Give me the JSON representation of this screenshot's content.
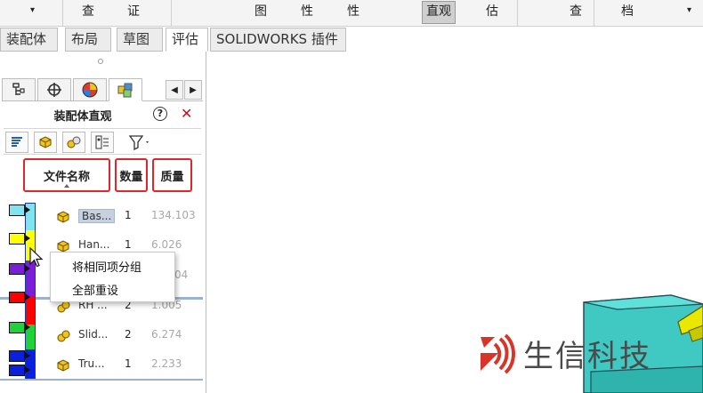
{
  "ribbon": {
    "items": [
      "▾",
      "查",
      "证",
      "图",
      "性",
      "性",
      "直观",
      "估",
      "查",
      "档",
      "▾"
    ]
  },
  "tabs": [
    {
      "label": "装配体"
    },
    {
      "label": "布局"
    },
    {
      "label": "草图"
    },
    {
      "label": "评估"
    },
    {
      "label": "SOLIDWORKS 插件"
    }
  ],
  "panel": {
    "title": "装配体直观",
    "help": "?",
    "close": "✕"
  },
  "columns": {
    "name": "文件名称",
    "qty": "数量",
    "mass": "质量"
  },
  "rows": [
    {
      "name": "Bas...",
      "qty": "1",
      "mass": "134.103"
    },
    {
      "name": "Han...",
      "qty": "1",
      "mass": "6.026"
    },
    {
      "name": "",
      "qty": "",
      "mass": "04"
    },
    {
      "name": "RH ...",
      "qty": "2",
      "mass": "1.005"
    },
    {
      "name": "Slid...",
      "qty": "2",
      "mass": "6.274"
    },
    {
      "name": "Tru...",
      "qty": "1",
      "mass": "2.233"
    }
  ],
  "context_menu": {
    "items": [
      "将相同项分组",
      "全部重设"
    ]
  },
  "watermark": {
    "text": "生信科技"
  },
  "colors": {
    "legend": [
      "#7fe3f0",
      "#ffff00",
      "#7a1ed8",
      "#ff0000",
      "#1fd23a",
      "#0a1fe0"
    ],
    "highlight_border": "#e0262b",
    "accent_blue": "#9ab2cf"
  }
}
